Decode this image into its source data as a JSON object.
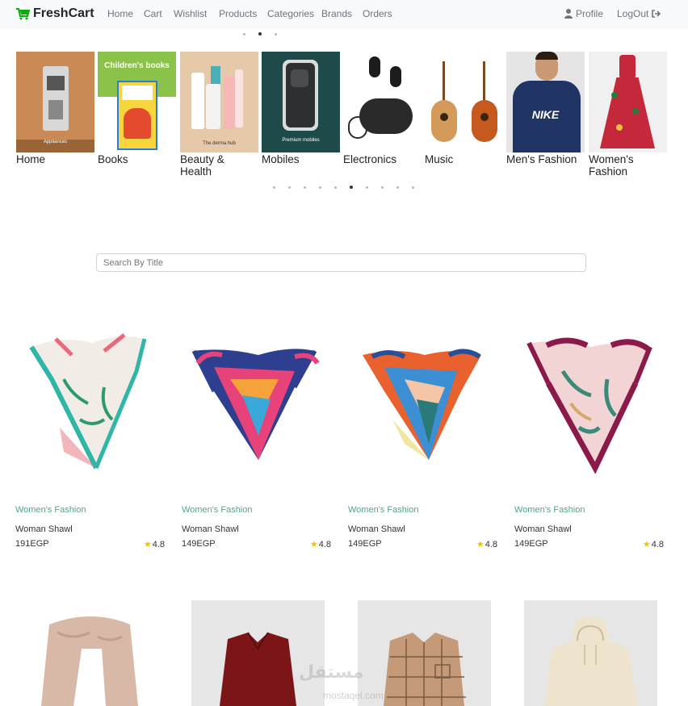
{
  "nav": {
    "brand": "FreshCart",
    "links": [
      "Home",
      "Cart",
      "Wishlist",
      "Products",
      "Categories",
      "Brands",
      "Orders"
    ],
    "profile": "Profile",
    "logout": "LogOut"
  },
  "top_slider": {
    "dots": 3,
    "active": 1
  },
  "categories": [
    {
      "label": "Home",
      "image_text": "Appliances"
    },
    {
      "label": "Books",
      "image_text": "Children's books"
    },
    {
      "label": "Beauty & Health",
      "image_text": "The derma hub"
    },
    {
      "label": "Mobiles",
      "image_text": "Premium mobiles"
    },
    {
      "label": "Electronics",
      "image_text": ""
    },
    {
      "label": "Music",
      "image_text": ""
    },
    {
      "label": "Men's Fashion",
      "image_text": "NIKE"
    },
    {
      "label": "Women's Fashion",
      "image_text": ""
    }
  ],
  "category_slider": {
    "dots": 10,
    "active": 5
  },
  "search": {
    "placeholder": "Search By Title",
    "value": ""
  },
  "products": [
    {
      "category": "Women's Fashion",
      "title": "Woman Shawl",
      "price": "191EGP",
      "rating": "4.8"
    },
    {
      "category": "Women's Fashion",
      "title": "Woman Shawl",
      "price": "149EGP",
      "rating": "4.8"
    },
    {
      "category": "Women's Fashion",
      "title": "Woman Shawl",
      "price": "149EGP",
      "rating": "4.8"
    },
    {
      "category": "Women's Fashion",
      "title": "Woman Shawl",
      "price": "149EGP",
      "rating": "4.8"
    }
  ],
  "colors": {
    "accent": "#4fa58a",
    "brand_icon": "#0aad0a",
    "star": "#f2c200",
    "navbar_bg": "#f8f9fa"
  },
  "watermark": {
    "main": "مستقل",
    "sub": "mostaqel.com"
  }
}
